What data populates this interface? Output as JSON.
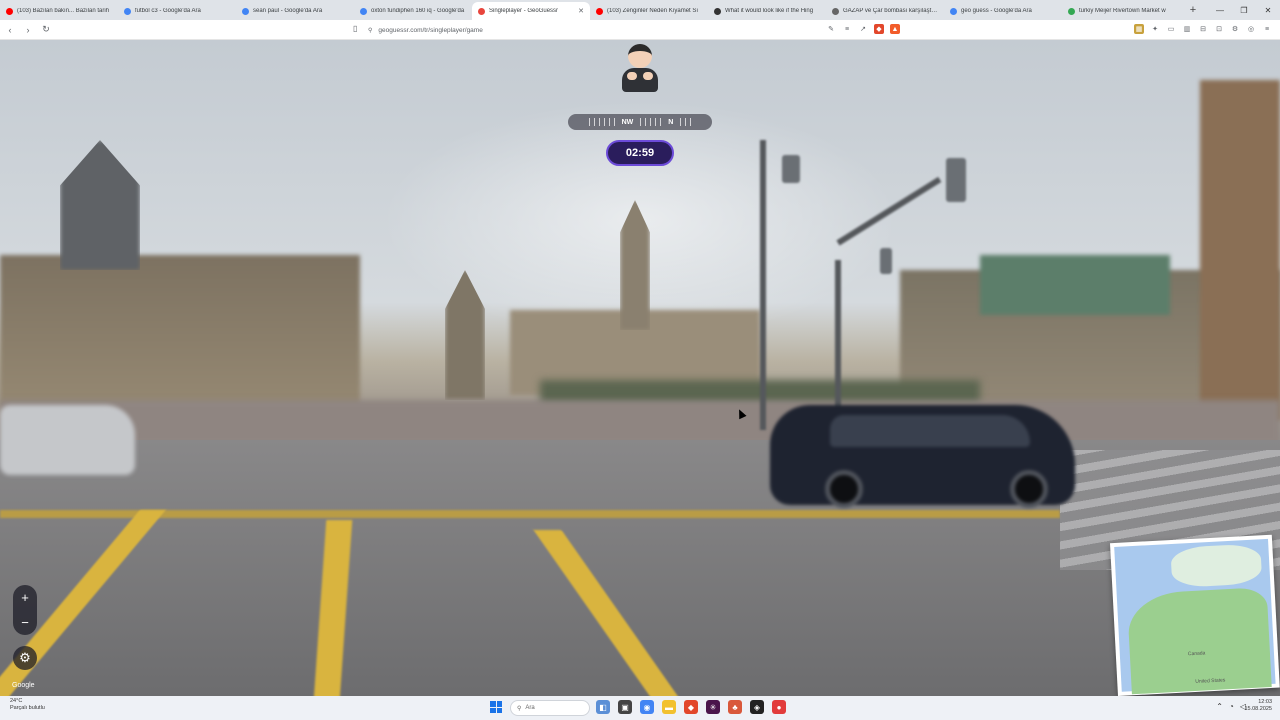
{
  "browser": {
    "tabs": [
      {
        "title": "(103) Bazılan bakın... Bazılan tarih",
        "favicon_color": "#ff0000",
        "active": false
      },
      {
        "title": "futbol c3 - Google'da Ara",
        "favicon_color": "#4285f4",
        "active": false
      },
      {
        "title": "sean paul - Google'da Ara",
        "favicon_color": "#4285f4",
        "active": false
      },
      {
        "title": "oxton fundiphen 160 iq - Google'da",
        "favicon_color": "#4285f4",
        "active": false
      },
      {
        "title": "Singleplayer - GeoGuessr",
        "favicon_color": "#e8453c",
        "active": true
      },
      {
        "title": "(103) Zenginler Neden Kıyamet Sı",
        "favicon_color": "#ff0000",
        "active": false
      },
      {
        "title": "What it would look like if the Hing",
        "favicon_color": "#333333",
        "active": false
      },
      {
        "title": "GAZAP ve Çar bombası karşılaştırm",
        "favicon_color": "#666666",
        "active": false
      },
      {
        "title": "geo guess - Google'da Ara",
        "favicon_color": "#4285f4",
        "active": false
      },
      {
        "title": "turkiy Meijer Rivertown Market w",
        "favicon_color": "#34a853",
        "active": false
      }
    ],
    "new_tab": "+",
    "window_controls": {
      "minimize": "—",
      "restore": "❐",
      "close": "✕"
    },
    "tab_close": "✕",
    "address": "geoguessr.com/tr/singleplayer/game",
    "nav": {
      "back": "‹",
      "forward": "›",
      "reload": "↻"
    }
  },
  "game": {
    "compass": {
      "label_primary": "NW",
      "label_secondary": "N"
    },
    "timer": "02:59",
    "zoom_in": "+",
    "zoom_out": "−",
    "settings_glyph": "⚙",
    "google_mark": "Google",
    "minimap_labels": {
      "canada": "Canada",
      "usa": "United States"
    }
  },
  "taskbar": {
    "weather_temp": "24°C",
    "weather_desc": "Parçalı bulutlu",
    "search_placeholder": "Ara",
    "clock_time": "12:03",
    "clock_date": "15.08.2025"
  }
}
